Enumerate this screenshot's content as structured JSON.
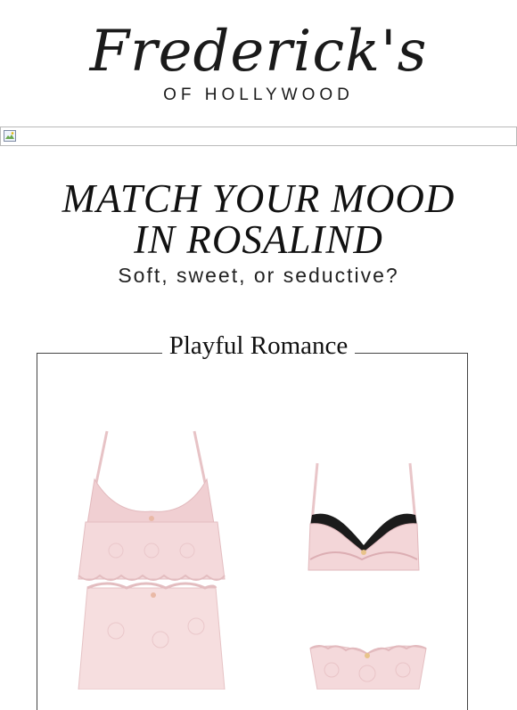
{
  "brand": {
    "script": "Frederick's",
    "sub": "OF HOLLYWOOD"
  },
  "banner": {
    "alt": ""
  },
  "hero": {
    "line1": "MATCH YOUR MOOD",
    "line2": "IN ROSALIND",
    "subtitle": "Soft, sweet, or seductive?"
  },
  "section": {
    "title": "Playful Romance"
  },
  "products": [
    {
      "name": "pink-lace-cami-set-image"
    },
    {
      "name": "pink-bra-image"
    },
    {
      "name": "pink-lace-panty-image"
    }
  ],
  "colors": {
    "blush": "#f3d6d8",
    "lace_black": "#1b1b1b",
    "frame": "#444444"
  }
}
